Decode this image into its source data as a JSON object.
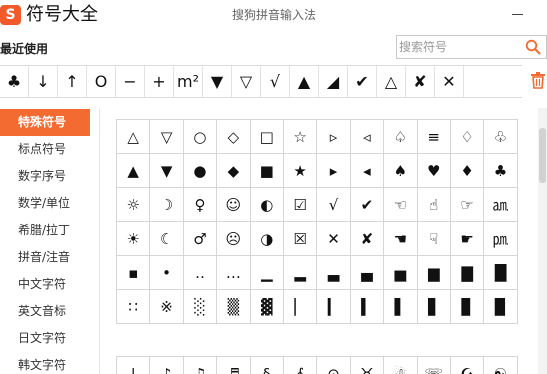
{
  "titlebar": {
    "logo_glyph": "S",
    "app_title": "符号大全",
    "subtitle": "搜狗拼音输入法"
  },
  "recent": {
    "label": "最近使用",
    "search_placeholder": "搜索符号",
    "symbols": [
      "♣",
      "↓",
      "↑",
      "O",
      "−",
      "+",
      "m²",
      "▼",
      "▽",
      "√",
      "▲",
      "◢",
      "✔",
      "△",
      "✘",
      "✕"
    ]
  },
  "sidebar": {
    "items": [
      {
        "label": "特殊符号",
        "active": true
      },
      {
        "label": "标点符号"
      },
      {
        "label": "数字序号"
      },
      {
        "label": "数学/单位"
      },
      {
        "label": "希腊/拉丁"
      },
      {
        "label": "拼音/注音"
      },
      {
        "label": "中文字符"
      },
      {
        "label": "英文音标"
      },
      {
        "label": "日文字符"
      },
      {
        "label": "韩文字符"
      }
    ]
  },
  "grid": {
    "rows": [
      [
        "△",
        "▽",
        "○",
        "◇",
        "□",
        "☆",
        "▹",
        "◃",
        "♤",
        "≡",
        "♢",
        "♧"
      ],
      [
        "▲",
        "▼",
        "●",
        "◆",
        "■",
        "★",
        "▸",
        "◂",
        "♠",
        "♥",
        "♦",
        "♣"
      ],
      [
        "☼",
        "☽",
        "♀",
        "☺",
        "◐",
        "☑",
        "√",
        "✔",
        "☜",
        "☝",
        "☞",
        "㏂"
      ],
      [
        "☀",
        "☾",
        "♂",
        "☹",
        "◑",
        "☒",
        "✕",
        "✘",
        "☚",
        "☟",
        "☛",
        "㏘"
      ],
      [
        "▪",
        "•",
        "‥",
        "…",
        "▁",
        "▂",
        "▃",
        "▄",
        "▅",
        "▆",
        "▇",
        "█"
      ],
      [
        "∷",
        "※",
        "░",
        "▒",
        "▓",
        "▏",
        "▎",
        "▍",
        "▌",
        "▋",
        "▊",
        "▉"
      ]
    ],
    "partial_row": [
      "↓",
      "♪",
      "♫",
      "♬",
      "§",
      "∮",
      "⊙",
      "♉",
      "☃",
      "☏",
      "☪",
      "☯"
    ]
  },
  "colors": {
    "accent": "#f36b30",
    "border": "#d6d6d6"
  },
  "icons": {
    "search": "search-icon",
    "trash": "trash-icon"
  }
}
